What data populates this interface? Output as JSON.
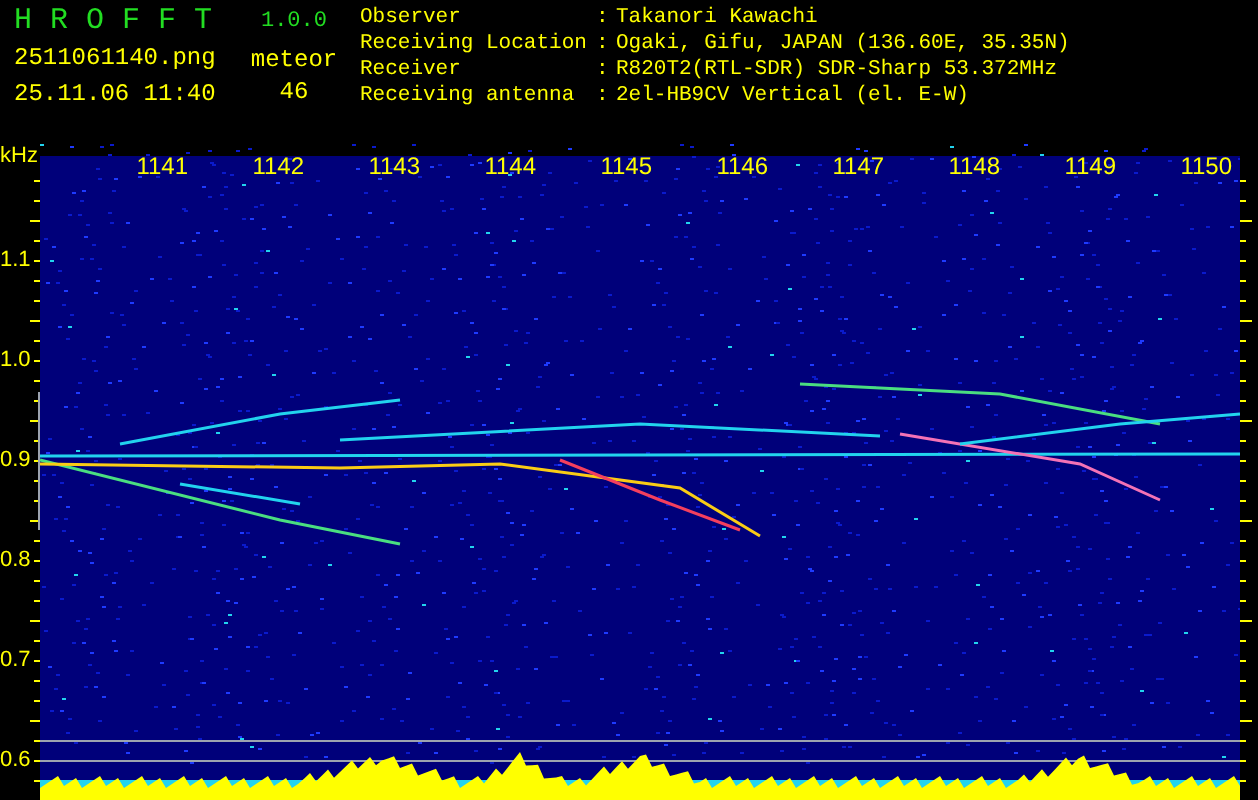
{
  "header": {
    "app_name": "H R O F F T",
    "version": "1.0.0",
    "filename": "2511061140.png",
    "datetime": "25.11.06 11:40",
    "count_label": "meteor",
    "count": "46"
  },
  "info": [
    {
      "label": "Observer",
      "separator": ":",
      "value": "Takanori Kawachi"
    },
    {
      "label": "Receiving Location",
      "separator": ":",
      "value": "Ogaki, Gifu, JAPAN (136.60E, 35.35N)"
    },
    {
      "label": "Receiver",
      "separator": ":",
      "value": "R820T2(RTL-SDR) SDR-Sharp 53.372MHz"
    },
    {
      "label": "Receiving antenna",
      "separator": ":",
      "value": "2el-HB9CV Vertical (el. E-W)"
    }
  ],
  "time_axis": {
    "ticks": [
      "1141",
      "1142",
      "1143",
      "1144",
      "1145",
      "1146",
      "1147",
      "1148",
      "1149",
      "1150"
    ]
  },
  "freq_axis": {
    "unit": "kHz",
    "ticks": [
      "1.1",
      "1.0",
      "0.9",
      "0.8",
      "0.7",
      "0.6"
    ]
  }
}
